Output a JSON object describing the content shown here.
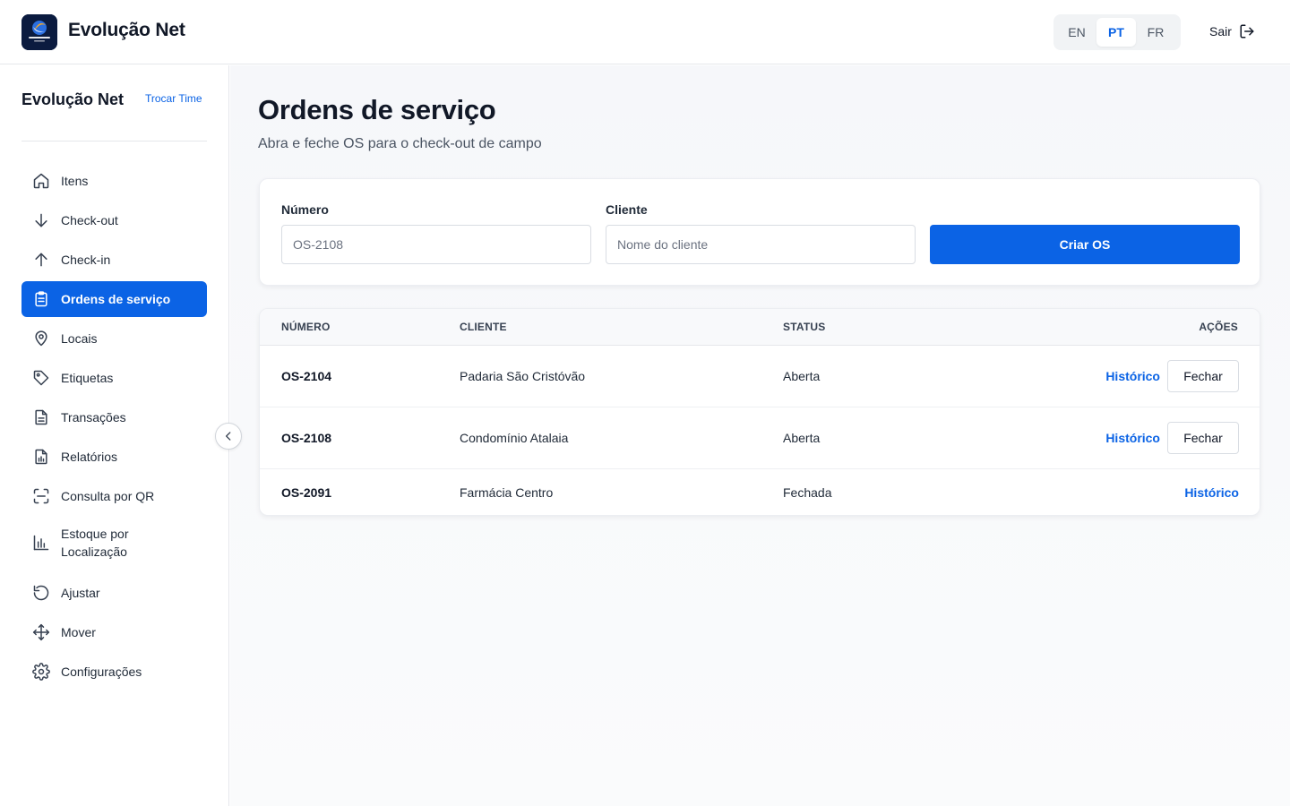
{
  "header": {
    "brand": "Evolução Net",
    "languages": [
      {
        "code": "EN",
        "active": false
      },
      {
        "code": "PT",
        "active": true
      },
      {
        "code": "FR",
        "active": false
      }
    ],
    "logout_label": "Sair",
    "logout_icon": "logout-icon"
  },
  "sidebar": {
    "team_name": "Evolução Net",
    "switch_team_label": "Trocar Time",
    "items": [
      {
        "label": "Itens",
        "icon": "home-icon",
        "active": false
      },
      {
        "label": "Check-out",
        "icon": "arrow-down-icon",
        "active": false
      },
      {
        "label": "Check-in",
        "icon": "arrow-up-icon",
        "active": false
      },
      {
        "label": "Ordens de serviço",
        "icon": "clipboard-icon",
        "active": true
      },
      {
        "label": "Locais",
        "icon": "map-pin-icon",
        "active": false
      },
      {
        "label": "Etiquetas",
        "icon": "tag-icon",
        "active": false
      },
      {
        "label": "Transações",
        "icon": "document-icon",
        "active": false
      },
      {
        "label": "Relatórios",
        "icon": "report-icon",
        "active": false
      },
      {
        "label": "Consulta por QR",
        "icon": "qr-scan-icon",
        "active": false
      },
      {
        "label": "Estoque por Localização",
        "icon": "bar-chart-icon",
        "active": false
      },
      {
        "label": "Ajustar",
        "icon": "rotate-icon",
        "active": false
      },
      {
        "label": "Mover",
        "icon": "move-icon",
        "active": false
      },
      {
        "label": "Configurações",
        "icon": "gear-icon",
        "active": false
      }
    ],
    "collapse_icon": "chevron-left-icon"
  },
  "main": {
    "title": "Ordens de serviço",
    "subtitle": "Abra e feche OS para o check-out de campo",
    "form": {
      "number_label": "Número",
      "number_placeholder": "OS-2108",
      "client_label": "Cliente",
      "client_placeholder": "Nome do cliente",
      "create_label": "Criar OS"
    },
    "table": {
      "headers": {
        "number": "NÚMERO",
        "client": "CLIENTE",
        "status": "STATUS",
        "actions": "AÇÕES"
      },
      "rows": [
        {
          "number": "OS-2104",
          "client": "Padaria São Cristóvão",
          "status": "Aberta",
          "history_label": "Histórico",
          "close_label": "Fechar"
        },
        {
          "number": "OS-2108",
          "client": "Condomínio Atalaia",
          "status": "Aberta",
          "history_label": "Histórico",
          "close_label": "Fechar"
        },
        {
          "number": "OS-2091",
          "client": "Farmácia Centro",
          "status": "Fechada",
          "history_label": "Histórico",
          "close_label": ""
        }
      ]
    }
  },
  "colors": {
    "accent": "#0b63e5",
    "text": "#111827",
    "border": "#e5e7eb"
  }
}
